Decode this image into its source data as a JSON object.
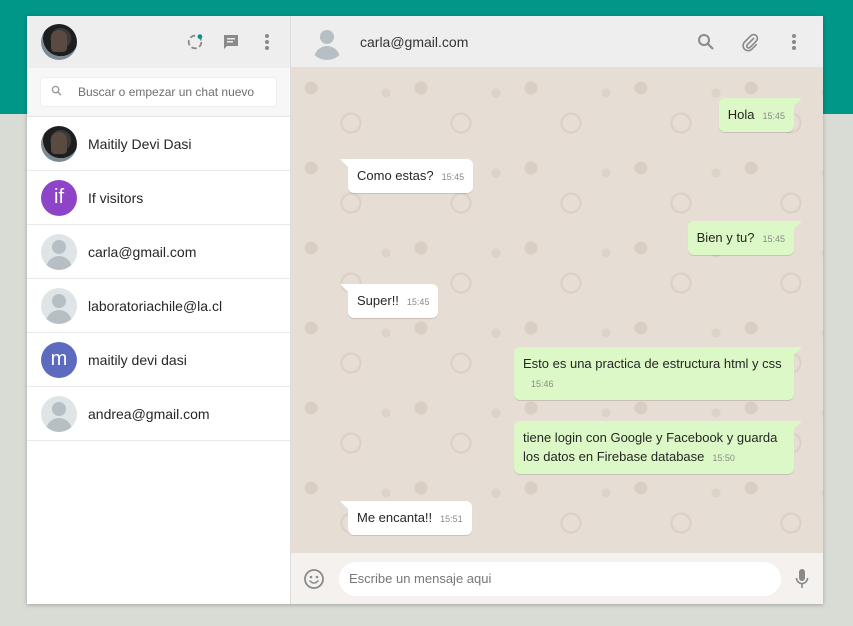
{
  "sidebar": {
    "search_placeholder": "Buscar o empezar un chat nuevo",
    "chats": [
      {
        "name": "Maitily Devi Dasi",
        "avatar": "photo"
      },
      {
        "name": "If visitors",
        "avatar": "letter",
        "letter": "if",
        "color": "#8e44c9"
      },
      {
        "name": "carla@gmail.com",
        "avatar": "default"
      },
      {
        "name": "laboratoriachile@la.cl",
        "avatar": "default"
      },
      {
        "name": "maitily devi dasi",
        "avatar": "letter",
        "letter": "m",
        "color": "#5c6bc0"
      },
      {
        "name": "andrea@gmail.com",
        "avatar": "default"
      }
    ]
  },
  "conversation": {
    "contact": "carla@gmail.com",
    "messages": [
      {
        "text": "Hola",
        "time": "15:45",
        "direction": "out"
      },
      {
        "text": "Como estas?",
        "time": "15:45",
        "direction": "in"
      },
      {
        "text": "Bien y tu?",
        "time": "15:45",
        "direction": "out"
      },
      {
        "text": "Super!!",
        "time": "15:45",
        "direction": "in"
      },
      {
        "text": "Esto es una practica de estructura html y css",
        "time": "15:46",
        "direction": "out"
      },
      {
        "text": "tiene login con Google y Facebook y guarda los datos en Firebase database",
        "time": "15:50",
        "direction": "out"
      },
      {
        "text": "Me encanta!!",
        "time": "15:51",
        "direction": "in"
      }
    ]
  },
  "composer": {
    "placeholder": "Escribe un mensaje aqui"
  },
  "colors": {
    "accent": "#009688",
    "outgoing_bubble": "#dcf8c6",
    "status_dot": "#009688"
  },
  "icons": [
    "status-icon",
    "chat-icon",
    "menu-icon",
    "search-icon",
    "attach-icon",
    "emoji-icon",
    "mic-icon"
  ]
}
